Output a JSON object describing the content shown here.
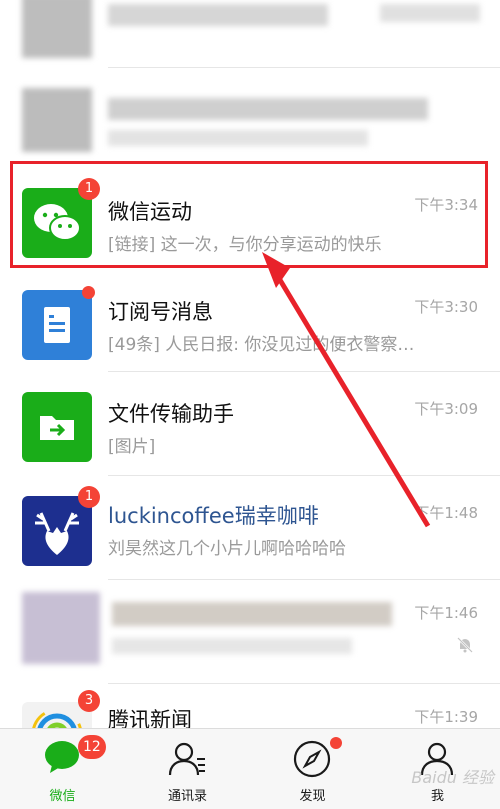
{
  "chats": [
    {
      "id": "wechat-sport",
      "title": "微信运动",
      "preview": "[链接] 这一次，与你分享运动的快乐",
      "time": "下午3:34",
      "badge": "1"
    },
    {
      "id": "subscriptions",
      "title": "订阅号消息",
      "preview": "[49条] 人民日报: 你没见过的便衣警察…",
      "time": "下午3:30"
    },
    {
      "id": "file-transfer",
      "title": "文件传输助手",
      "preview": "[图片]",
      "time": "下午3:09"
    },
    {
      "id": "luckin",
      "title": "luckincoffee瑞幸咖啡",
      "preview": "刘昊然这几个小片儿啊哈哈哈哈",
      "time": "下午1:48",
      "badge": "1"
    },
    {
      "id": "blurred-group",
      "title": "",
      "preview": "",
      "time": "下午1:46"
    },
    {
      "id": "tencent-news",
      "title": "腾讯新闻",
      "preview": "",
      "time": "下午1:39",
      "badge": "3"
    }
  ],
  "tabbar": {
    "items": [
      {
        "label": "微信",
        "badge": "12"
      },
      {
        "label": "通讯录"
      },
      {
        "label": "发现"
      },
      {
        "label": "我"
      }
    ]
  },
  "colors": {
    "accent": "#1aad19",
    "badge": "#f44336",
    "highlight": "#e8222a"
  },
  "watermark": "Baidu 经验"
}
